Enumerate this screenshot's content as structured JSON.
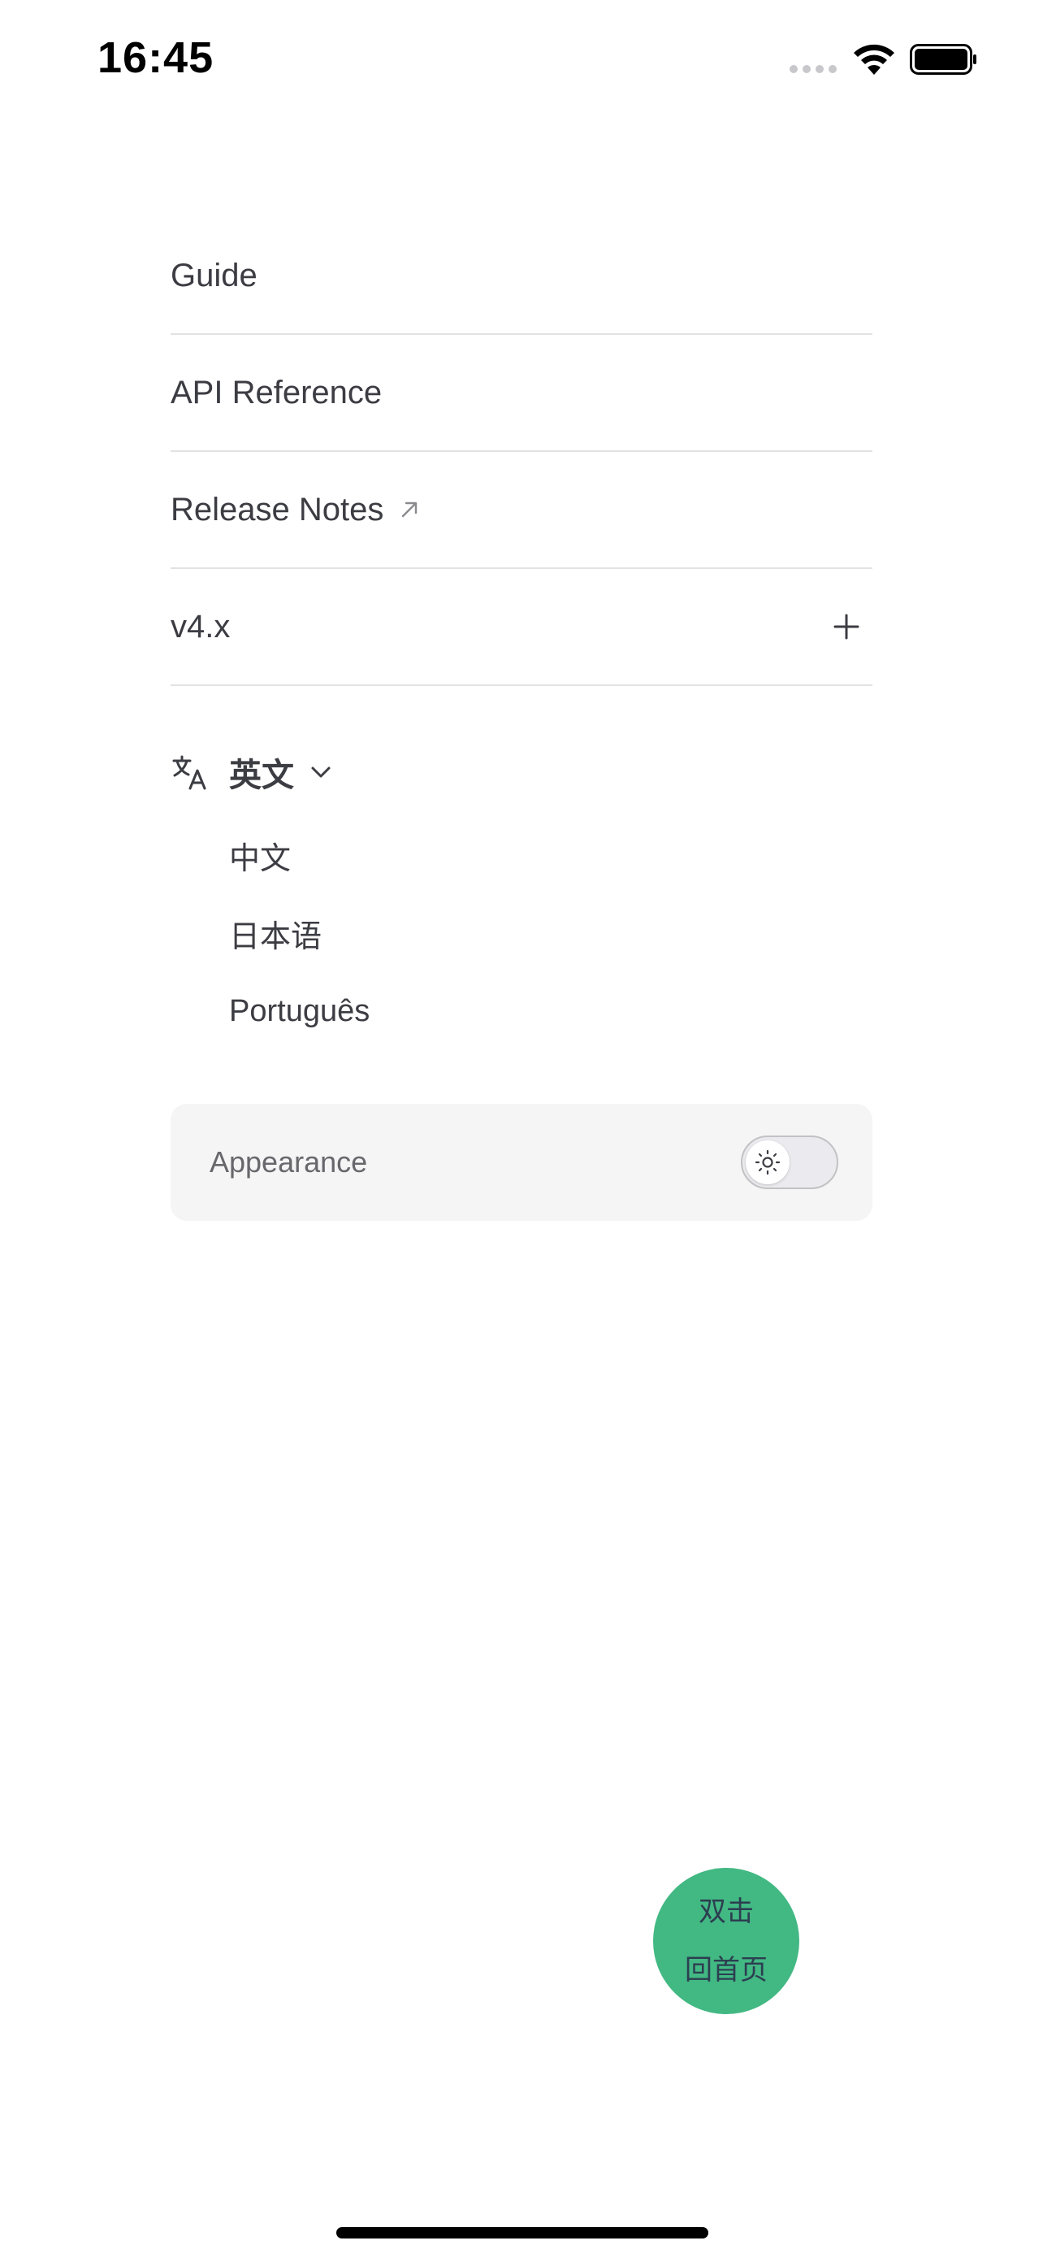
{
  "status_bar": {
    "time": "16:45"
  },
  "menu": {
    "items": [
      {
        "label": "Guide"
      },
      {
        "label": "API Reference"
      },
      {
        "label": "Release Notes",
        "icon": "external-link-icon"
      },
      {
        "label": "v4.x",
        "icon": "plus-icon"
      }
    ]
  },
  "language": {
    "current": "英文",
    "options": [
      "中文",
      "日本语",
      "Português"
    ]
  },
  "appearance": {
    "label": "Appearance",
    "mode": "light"
  },
  "fab": {
    "line1": "双击",
    "line2": "回首页",
    "color": "#42b883"
  }
}
